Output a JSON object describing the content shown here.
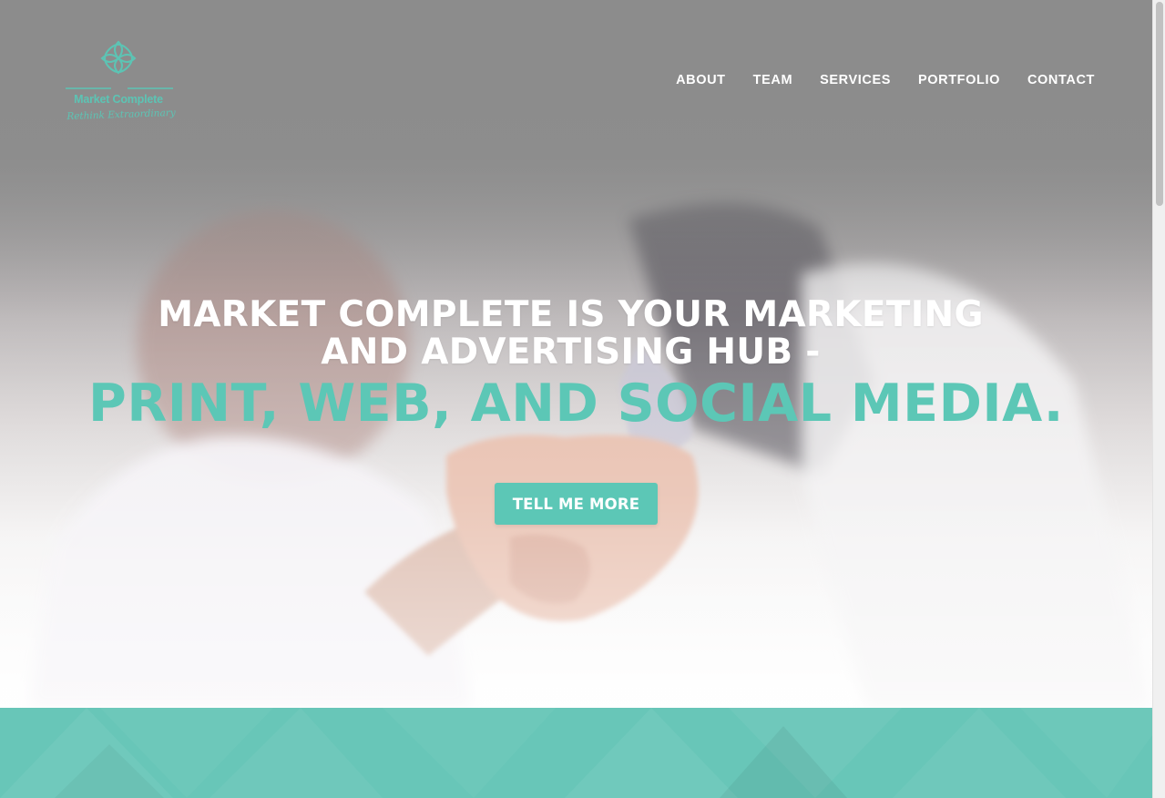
{
  "brand": {
    "name": "Market Complete",
    "tagline": "Rethink Extraordinary",
    "logo_icon": "quatrefoil-flower-icon",
    "accent_color": "#5cc7b6"
  },
  "nav": {
    "items": [
      {
        "label": "ABOUT"
      },
      {
        "label": "TEAM"
      },
      {
        "label": "SERVICES"
      },
      {
        "label": "PORTFOLIO"
      },
      {
        "label": "CONTACT"
      }
    ]
  },
  "hero": {
    "headline_line1": "MARKET COMPLETE IS YOUR MARKETING",
    "headline_line2": "AND ADVERTISING HUB -",
    "subheadline": "PRINT, WEB, AND SOCIAL MEDIA.",
    "cta_label": "TELL ME MORE",
    "background_image": "handshake-photo"
  }
}
